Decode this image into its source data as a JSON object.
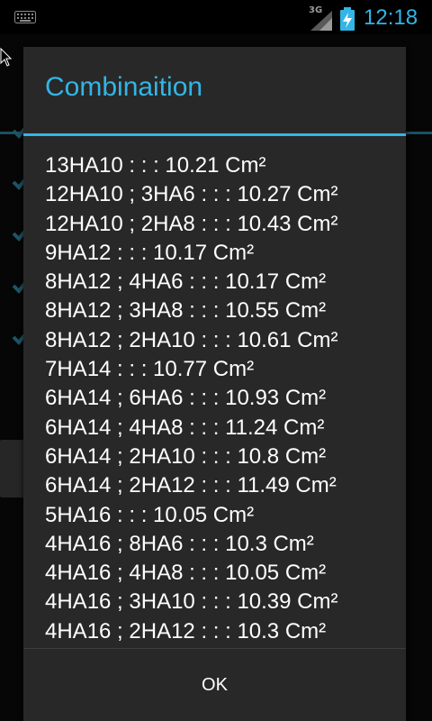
{
  "status_bar": {
    "network_type": "3G",
    "time": "12:18",
    "icons": [
      "keyboard-icon",
      "signal-icon",
      "battery-charging-icon"
    ]
  },
  "dialog": {
    "title": "Combinaition",
    "items": [
      "13HA10 : : : 10.21 Cm²",
      "12HA10 ; 3HA6 : : : 10.27 Cm²",
      "12HA10 ; 2HA8 : : : 10.43 Cm²",
      "9HA12 : : : 10.17 Cm²",
      "8HA12 ; 4HA6 : : : 10.17 Cm²",
      "8HA12 ; 3HA8 : : : 10.55 Cm²",
      "8HA12 ; 2HA10 : : : 10.61 Cm²",
      "7HA14 : : : 10.77 Cm²",
      "6HA14 ; 6HA6 : : : 10.93 Cm²",
      "6HA14 ; 4HA8 : : : 11.24 Cm²",
      "6HA14 ; 2HA10 : : : 10.8 Cm²",
      "6HA14 ; 2HA12 : : : 11.49 Cm²",
      "5HA16 : : : 10.05 Cm²",
      "4HA16 ; 8HA6 : : : 10.3 Cm²",
      "4HA16 ; 4HA8 : : : 10.05 Cm²",
      "4HA16 ; 3HA10 : : : 10.39 Cm²",
      "4HA16 ; 2HA12 : : : 10.3 Cm²"
    ],
    "ok_label": "OK"
  },
  "colors": {
    "accent": "#33b5e5",
    "dialog_bg": "#282828",
    "text": "#ffffff"
  }
}
